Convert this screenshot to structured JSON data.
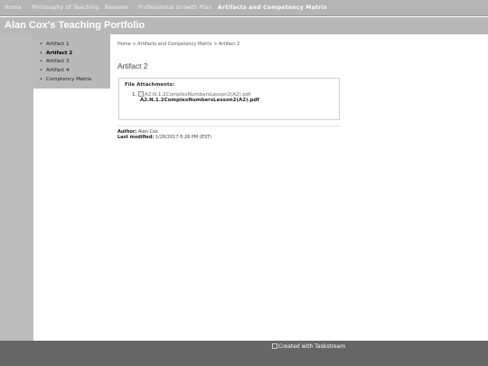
{
  "topnav": {
    "items": [
      {
        "label": "Home",
        "active": false
      },
      {
        "label": "Philosophy of Teaching",
        "active": false
      },
      {
        "label": "Resume",
        "active": false
      },
      {
        "label": "Professional Growth Plan",
        "active": false
      },
      {
        "label": "Artifacts and Competency Matrix",
        "active": true
      }
    ]
  },
  "site": {
    "title": "Alan Cox's Teaching Portfolio"
  },
  "sidebar": {
    "items": [
      {
        "label": "Artifact 1",
        "active": false
      },
      {
        "label": "Artifact 2",
        "active": true
      },
      {
        "label": "Artifact 3",
        "active": false
      },
      {
        "label": "Artifact 4",
        "active": false
      },
      {
        "label": "Comptency Matrix",
        "active": false
      }
    ]
  },
  "breadcrumb": {
    "home": "Home",
    "sep": ">",
    "section": "Artifacts and Competency Matrix",
    "current": "Artifact 2"
  },
  "page": {
    "title": "Artifact 2"
  },
  "attachments": {
    "heading": "File Attachments:",
    "items": [
      {
        "number": "1.",
        "image_alt": "A2.N.1.2ComplexNumbersLesson2(A2).pdf",
        "link": "A2.N.1.2ComplexNumbersLesson2(A2).pdf"
      }
    ]
  },
  "meta": {
    "author_label": "Author:",
    "author": "Alan Cox",
    "modified_label": "Last modified:",
    "modified": "1/28/2017 6:26 PM (EST)"
  },
  "footer": {
    "badge_alt": "Created with Taskstream"
  },
  "colors": {
    "topnav": "#b4b4b4",
    "titlebar": "#b8b8b8",
    "sidebar": "#b9b9b9",
    "footer": "#666666"
  }
}
